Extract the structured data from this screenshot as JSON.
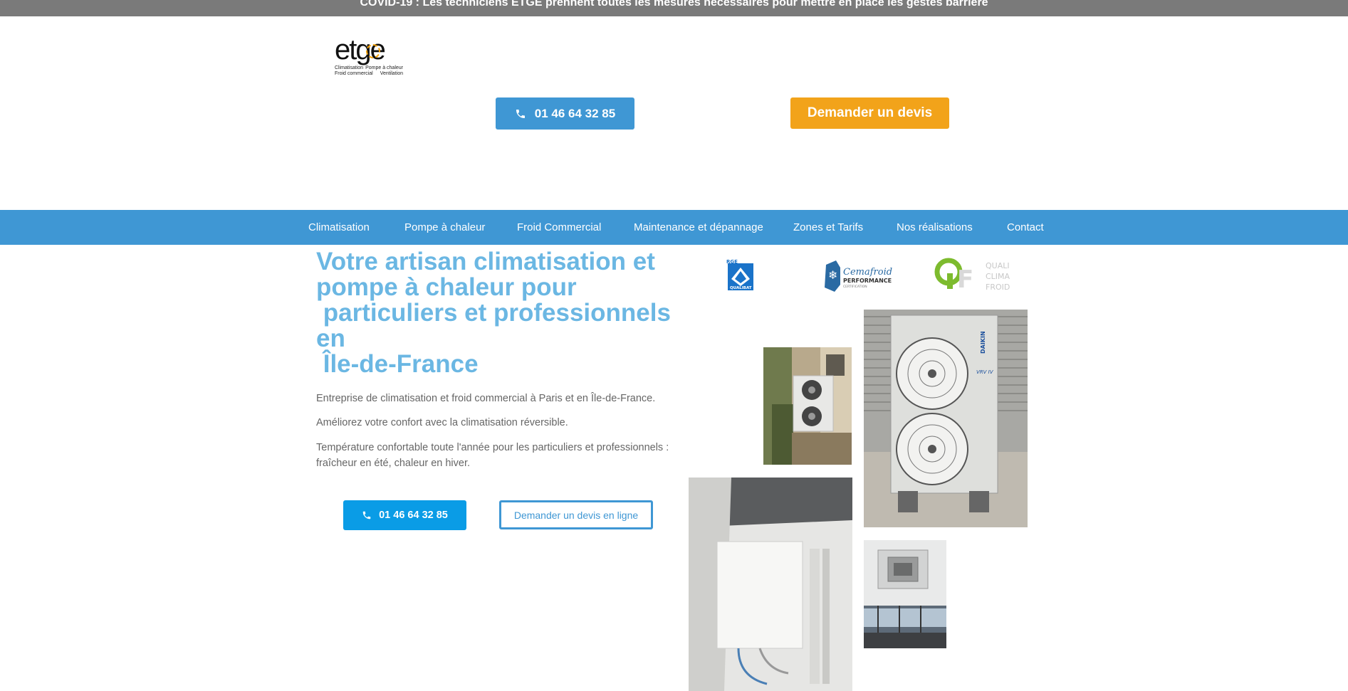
{
  "topbar": {
    "text": "COVID-19 : Les techniciens ETGE prennent toutes les mesures nécessaires pour mettre en place les gestes barrière"
  },
  "logo": {
    "word": "etge",
    "lines": [
      [
        "Climatisation",
        "Pompe à chaleur"
      ],
      [
        "Froid commercial",
        "Ventilation"
      ]
    ]
  },
  "header": {
    "phone_label": "01 46 64 32 85",
    "devis_label": "Demander un devis"
  },
  "nav": {
    "items": [
      "Climatisation",
      "Pompe à chaleur",
      "Froid Commercial",
      "Maintenance et dépannage",
      "Zones et Tarifs",
      "Nos réalisations",
      "Contact"
    ]
  },
  "hero": {
    "title": "Votre artisan climatisation et\npompe à chaleur pour\n particuliers et professionnels\nen\n Île-de-France",
    "p1": "Entreprise de climatisation et froid commercial à Paris et en Île-de-France.",
    "p2": "Améliorez votre confort avec la climatisation réversible.",
    "p3": "Température confortable toute l'année pour les particuliers et professionnels : fraîcheur en été, chaleur en hiver.",
    "phone_label": "01 46 64 32 85",
    "devis_label": "Demander un devis en ligne"
  },
  "badges": {
    "qualibat": {
      "top": "RGE",
      "label": "QUALIBAT"
    },
    "cemafroid": {
      "name": "Cemafroid",
      "sub": "PERFORMANCE",
      "tiny": "CERTIFICATION"
    },
    "qcf": {
      "lines": [
        "QUALI",
        "CLIMA",
        "FROID"
      ]
    }
  },
  "photos": {
    "daikin_brand": "DAIKIN",
    "daikin_model": "VRV IV"
  },
  "colors": {
    "primary": "#3f97d4",
    "orange": "#f2a31a",
    "title": "#6bb7e3",
    "topbar": "#7a7a7a",
    "hero_btn": "#0a9ce6"
  }
}
